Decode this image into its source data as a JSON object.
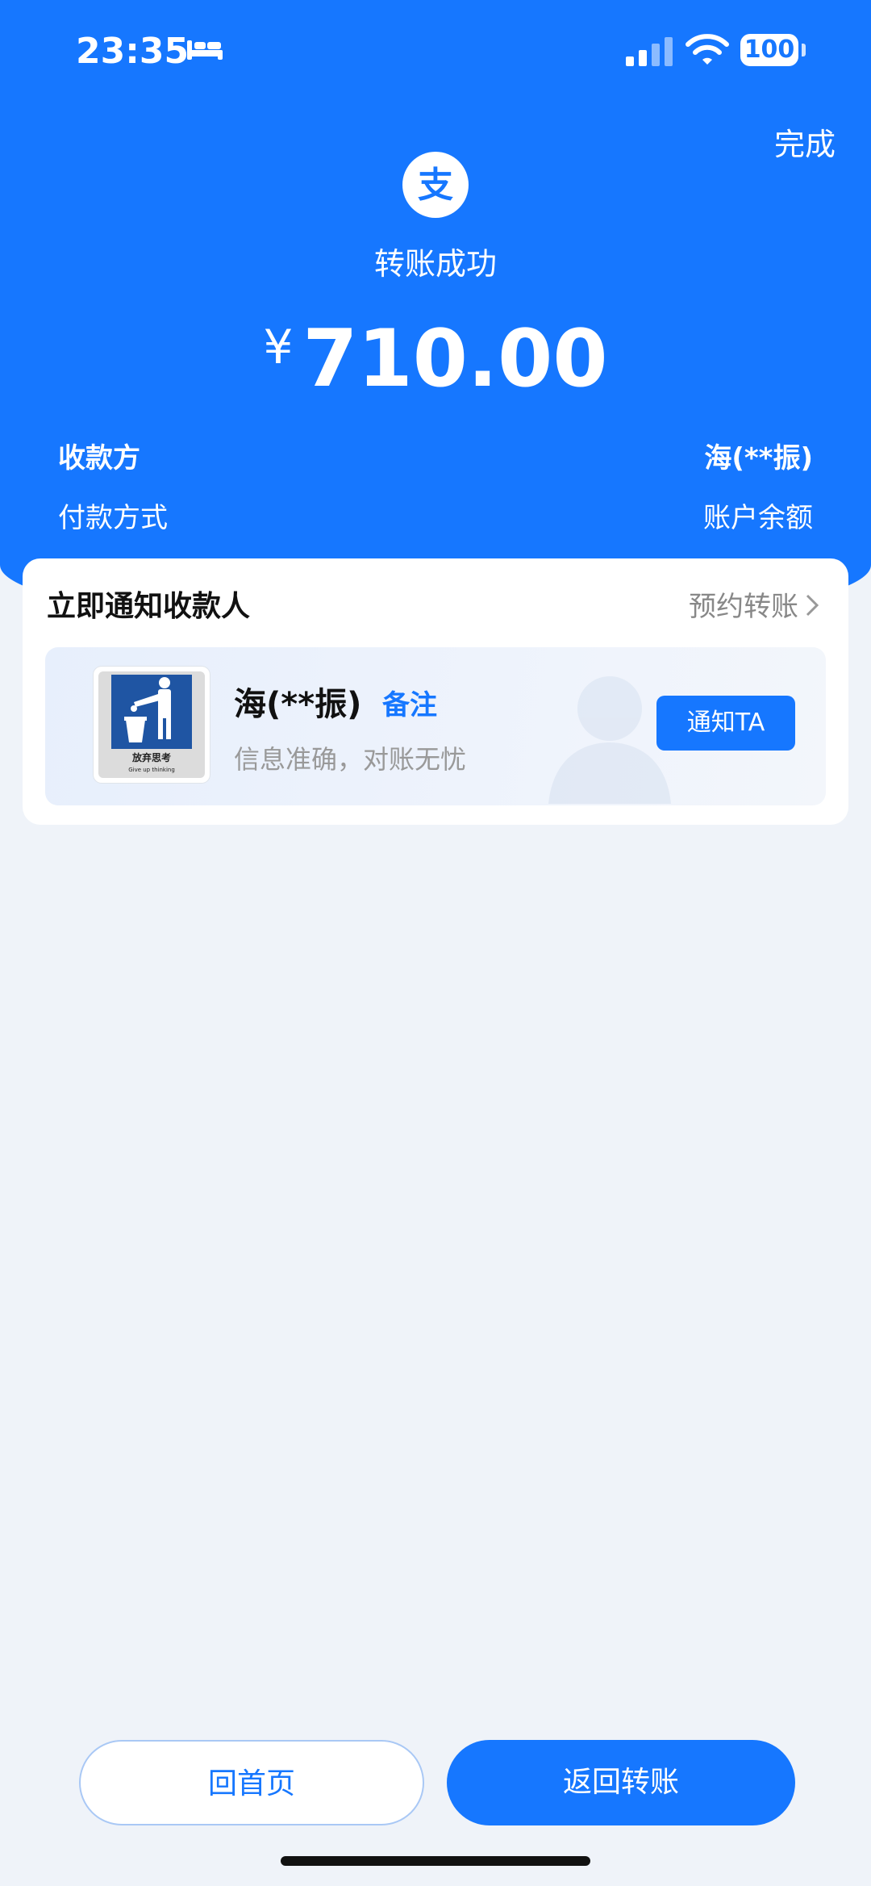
{
  "status_bar": {
    "time": "23:35",
    "battery": "100",
    "icons": [
      "bed-icon",
      "signal-icon",
      "wifi-icon",
      "battery-icon"
    ]
  },
  "header": {
    "done_label": "完成",
    "logo_icon": "alipay-logo-icon",
    "status_title": "转账成功",
    "currency_symbol": "¥",
    "amount": "710.00",
    "payee_label": "收款方",
    "payee_value": "海(**振)",
    "payment_method_label": "付款方式",
    "payment_method_value": "账户余额"
  },
  "notify_card": {
    "title": "立即通知收款人",
    "schedule_label": "预约转账",
    "recipient_name": "海(**振)",
    "remark_label": "备注",
    "tagline": "信息准确，对账无忧",
    "notify_button": "通知TA",
    "avatar_caption": "放弃思考",
    "avatar_caption_en": "Give up thinking"
  },
  "footer": {
    "home_button": "回首页",
    "back_button": "返回转账"
  },
  "colors": {
    "brand": "#1677ff",
    "page_bg": "#eff3f9",
    "muted_text": "#999999"
  }
}
